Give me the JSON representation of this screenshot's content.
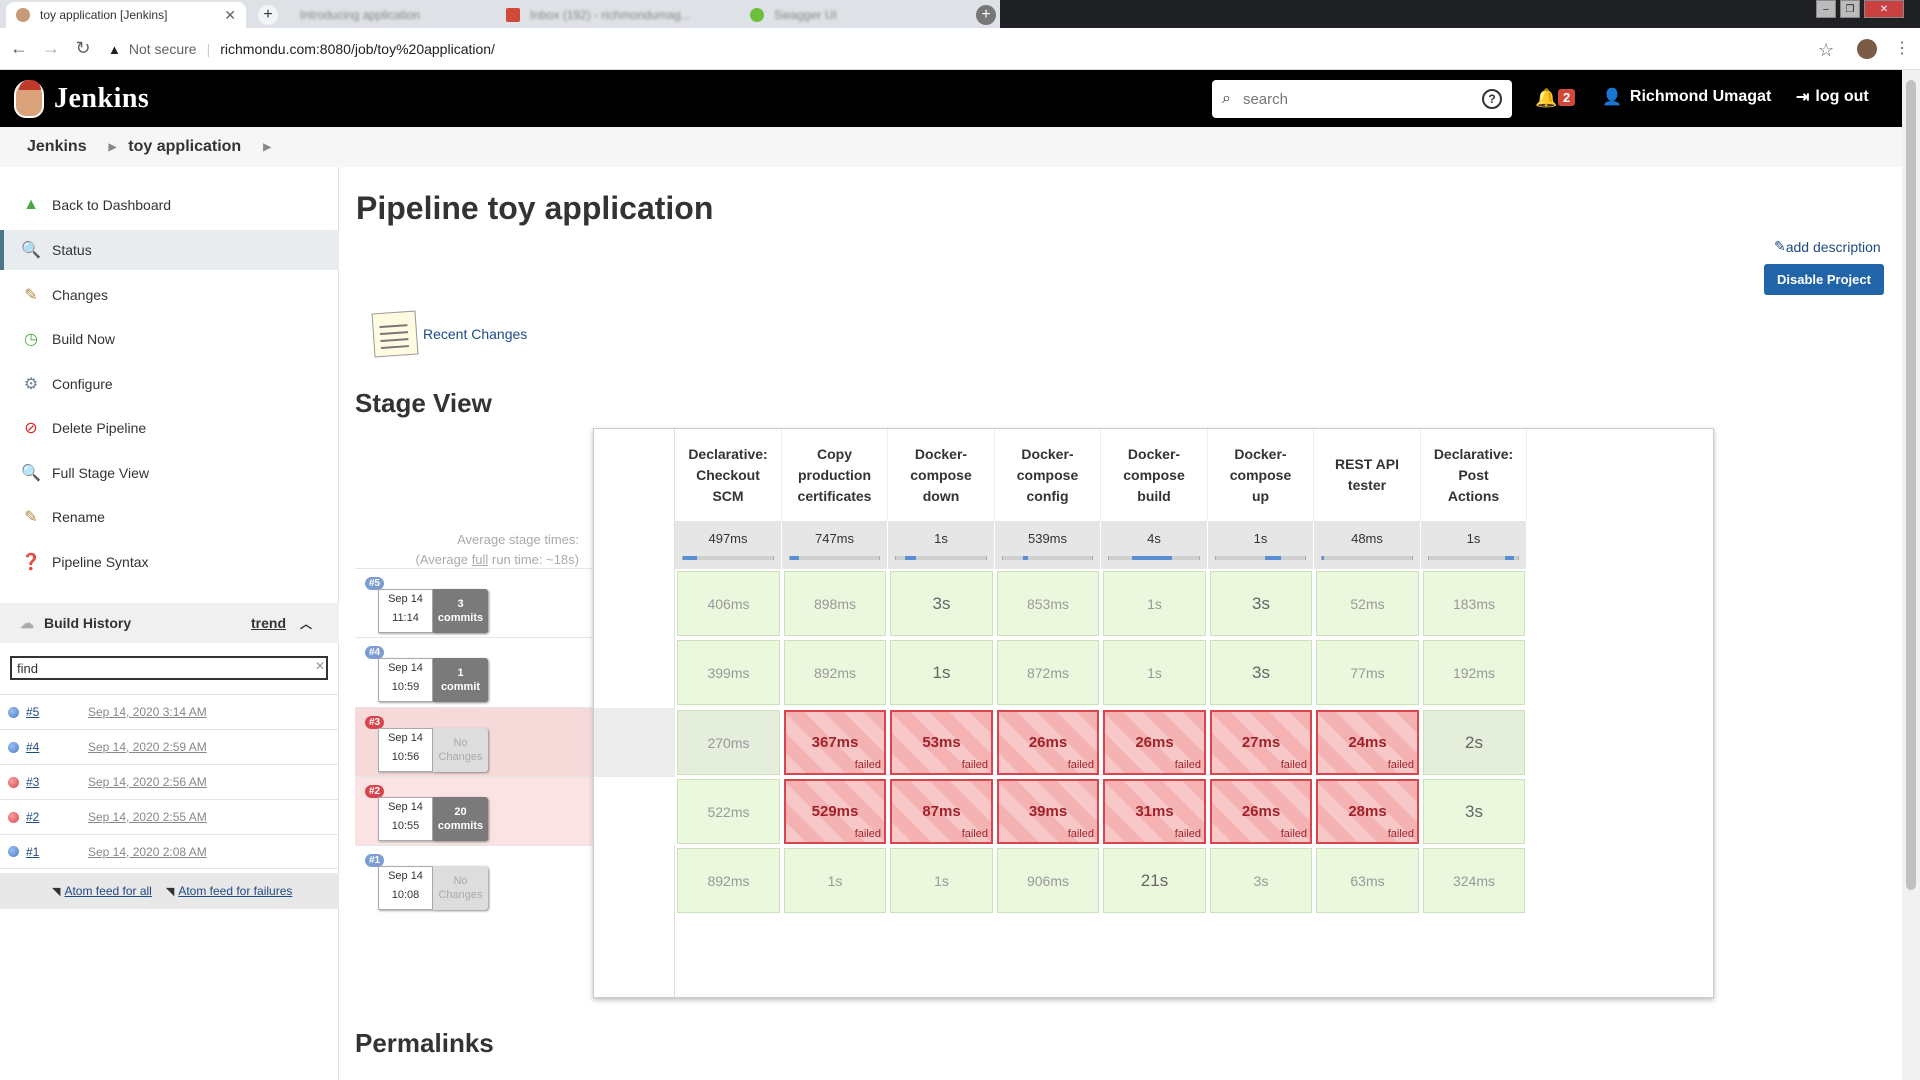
{
  "browser": {
    "active_tab_title": "toy application [Jenkins]",
    "bg_tabs": [
      "Introducing application",
      "Inbox (192) - richmondumag...",
      "Swagger UI"
    ],
    "security_label": "Not secure",
    "url": "richmondu.com:8080/job/toy%20application/"
  },
  "header": {
    "brand": "Jenkins",
    "search_placeholder": "search",
    "notification_count": "2",
    "user_name": "Richmond Umagat",
    "logout_label": "log out"
  },
  "breadcrumb": [
    "Jenkins",
    "toy application"
  ],
  "sidebar": {
    "tasks": [
      {
        "label": "Back to Dashboard",
        "icon": "up-arrow-icon"
      },
      {
        "label": "Status",
        "icon": "search-icon"
      },
      {
        "label": "Changes",
        "icon": "notepad-icon"
      },
      {
        "label": "Build Now",
        "icon": "clock-icon"
      },
      {
        "label": "Configure",
        "icon": "gear-icon"
      },
      {
        "label": "Delete Pipeline",
        "icon": "no-entry-icon"
      },
      {
        "label": "Full Stage View",
        "icon": "search-icon"
      },
      {
        "label": "Rename",
        "icon": "notepad-icon"
      },
      {
        "label": "Pipeline Syntax",
        "icon": "help-icon"
      }
    ],
    "build_history": {
      "title": "Build History",
      "trend_label": "trend",
      "find_value": "find",
      "builds": [
        {
          "num": "#5",
          "date": "Sep 14, 2020 3:14 AM",
          "status": "success"
        },
        {
          "num": "#4",
          "date": "Sep 14, 2020 2:59 AM",
          "status": "success"
        },
        {
          "num": "#3",
          "date": "Sep 14, 2020 2:56 AM",
          "status": "failed"
        },
        {
          "num": "#2",
          "date": "Sep 14, 2020 2:55 AM",
          "status": "failed"
        },
        {
          "num": "#1",
          "date": "Sep 14, 2020 2:08 AM",
          "status": "success"
        }
      ],
      "feed_all": "Atom feed for all",
      "feed_failures": "Atom feed for failures"
    }
  },
  "main": {
    "title": "Pipeline toy application",
    "add_description": "add description",
    "disable_button": "Disable Project",
    "recent_changes": "Recent Changes",
    "stage_view_title": "Stage View",
    "avg_label_line1": "Average stage times:",
    "avg_label_line2_pre": "(Average ",
    "avg_label_line2_full": "full",
    "avg_label_line2_post": " run time: ~18s)",
    "permalinks_title": "Permalinks"
  },
  "stage_view": {
    "stages": [
      {
        "name": "Declarative: Checkout SCM",
        "avg": "497ms",
        "avg_fraction": 0.15
      },
      {
        "name": "Copy production certificates",
        "avg": "747ms",
        "avg_fraction": 0.1
      },
      {
        "name": "Docker-compose down",
        "avg": "1s",
        "avg_fraction": 0.12
      },
      {
        "name": "Docker-compose config",
        "avg": "539ms",
        "avg_fraction": 0.06
      },
      {
        "name": "Docker-compose build",
        "avg": "4s",
        "avg_fraction": 0.45
      },
      {
        "name": "Docker-compose up",
        "avg": "1s",
        "avg_fraction": 0.18
      },
      {
        "name": "REST API tester",
        "avg": "48ms",
        "avg_fraction": 0.02
      },
      {
        "name": "Declarative: Post Actions",
        "avg": "1s",
        "avg_fraction": 0.1
      }
    ],
    "builds": [
      {
        "id": "#5",
        "date": "Sep 14",
        "time": "11:14",
        "changes_num": "3",
        "changes_word": "commits",
        "status": "success",
        "cells": [
          {
            "v": "406ms"
          },
          {
            "v": "898ms"
          },
          {
            "v": "3s",
            "big": true
          },
          {
            "v": "853ms"
          },
          {
            "v": "1s"
          },
          {
            "v": "3s",
            "big": true
          },
          {
            "v": "52ms"
          },
          {
            "v": "183ms"
          }
        ]
      },
      {
        "id": "#4",
        "date": "Sep 14",
        "time": "10:59",
        "changes_num": "1",
        "changes_word": "commit",
        "status": "success",
        "cells": [
          {
            "v": "399ms"
          },
          {
            "v": "892ms"
          },
          {
            "v": "1s",
            "big": true
          },
          {
            "v": "872ms"
          },
          {
            "v": "1s"
          },
          {
            "v": "3s",
            "big": true
          },
          {
            "v": "77ms"
          },
          {
            "v": "192ms"
          }
        ]
      },
      {
        "id": "#3",
        "date": "Sep 14",
        "time": "10:56",
        "changes_num": "",
        "changes_word": "No Changes",
        "status": "failed",
        "cells": [
          {
            "v": "270ms"
          },
          {
            "v": "367ms",
            "failed": true
          },
          {
            "v": "53ms",
            "failed": true
          },
          {
            "v": "26ms",
            "failed": true
          },
          {
            "v": "26ms",
            "failed": true
          },
          {
            "v": "27ms",
            "failed": true
          },
          {
            "v": "24ms",
            "failed": true
          },
          {
            "v": "2s",
            "big": true
          }
        ]
      },
      {
        "id": "#2",
        "date": "Sep 14",
        "time": "10:55",
        "changes_num": "20",
        "changes_word": "commits",
        "status": "failed",
        "cells": [
          {
            "v": "522ms"
          },
          {
            "v": "529ms",
            "failed": true
          },
          {
            "v": "87ms",
            "failed": true
          },
          {
            "v": "39ms",
            "failed": true
          },
          {
            "v": "31ms",
            "failed": true
          },
          {
            "v": "26ms",
            "failed": true
          },
          {
            "v": "28ms",
            "failed": true
          },
          {
            "v": "3s",
            "big": true
          }
        ]
      },
      {
        "id": "#1",
        "date": "Sep 14",
        "time": "10:08",
        "changes_num": "",
        "changes_word": "No Changes",
        "status": "success",
        "cells": [
          {
            "v": "892ms"
          },
          {
            "v": "1s"
          },
          {
            "v": "1s"
          },
          {
            "v": "906ms"
          },
          {
            "v": "21s",
            "big": true
          },
          {
            "v": "3s"
          },
          {
            "v": "63ms"
          },
          {
            "v": "324ms"
          }
        ]
      }
    ],
    "failed_label": "failed"
  },
  "colors": {
    "success_ball": "#4a7ac9",
    "failed_ball": "#d9454e",
    "brand_blue": "#2164a8",
    "header_bg": "#000000"
  }
}
